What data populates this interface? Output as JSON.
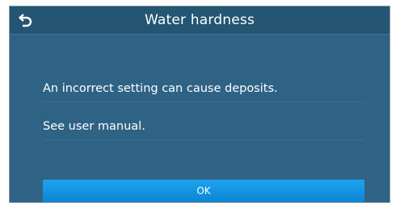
{
  "header": {
    "title": "Water hardness",
    "back_icon": "back-arrow-icon"
  },
  "message": {
    "line1": "An incorrect setting can cause deposits.",
    "line2": "See user manual."
  },
  "actions": {
    "ok_label": "OK"
  },
  "colors": {
    "screen_bg": "#2f6385",
    "titlebar_bg": "#245573",
    "button_bg": "#1796e2",
    "text": "#ffffff"
  }
}
